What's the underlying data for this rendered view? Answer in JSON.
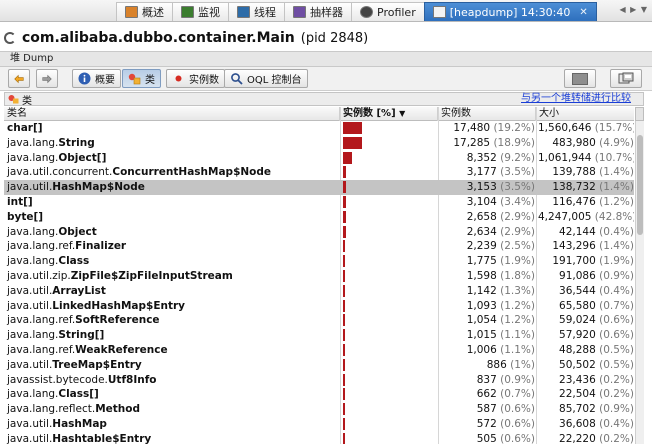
{
  "tabs": [
    {
      "label": "概述",
      "icon": "overview-icon"
    },
    {
      "label": "监视",
      "icon": "monitor-icon"
    },
    {
      "label": "线程",
      "icon": "threads-icon"
    },
    {
      "label": "抽样器",
      "icon": "sampler-icon"
    },
    {
      "label": "Profiler",
      "icon": "profiler-icon"
    },
    {
      "label": "[heapdump] 14:30:40",
      "icon": "heapdump-icon",
      "active": true
    }
  ],
  "header": {
    "app": "com.alibaba.dubbo.container.Main",
    "pid": "(pid 2848)"
  },
  "subtab": "堆 Dump",
  "toolbar": {
    "summary_label": "概要",
    "classes_label": "类",
    "instances_label": "实例数",
    "oql_label": "OQL 控制台"
  },
  "table": {
    "strip_label": "类",
    "compare_link": "与另一个堆转储进行比较",
    "columns": {
      "name": "类名",
      "instances_pct": "实例数 [%]",
      "instances": "实例数",
      "size": "大小"
    },
    "accent": "#b3181c",
    "rows": [
      {
        "pkg": "",
        "cls": "char[]",
        "count": "17,480",
        "count_pct": "(19.2%)",
        "size": "1,560,646",
        "size_pct": "(15.7%)",
        "frac": 19.2
      },
      {
        "pkg": "java.lang.",
        "cls": "String",
        "count": "17,285",
        "count_pct": "(18.9%)",
        "size": "483,980",
        "size_pct": "(4.9%)",
        "frac": 18.9
      },
      {
        "pkg": "java.lang.",
        "cls": "Object[]",
        "count": "8,352",
        "count_pct": "(9.2%)",
        "size": "1,061,944",
        "size_pct": "(10.7%)",
        "frac": 9.2
      },
      {
        "pkg": "java.util.concurrent.",
        "cls": "ConcurrentHashMap$Node",
        "count": "3,177",
        "count_pct": "(3.5%)",
        "size": "139,788",
        "size_pct": "(1.4%)",
        "frac": 3.5
      },
      {
        "pkg": "java.util.",
        "cls": "HashMap$Node",
        "count": "3,153",
        "count_pct": "(3.5%)",
        "size": "138,732",
        "size_pct": "(1.4%)",
        "frac": 3.5,
        "selected": true
      },
      {
        "pkg": "",
        "cls": "int[]",
        "count": "3,104",
        "count_pct": "(3.4%)",
        "size": "116,476",
        "size_pct": "(1.2%)",
        "frac": 3.4
      },
      {
        "pkg": "",
        "cls": "byte[]",
        "count": "2,658",
        "count_pct": "(2.9%)",
        "size": "4,247,005",
        "size_pct": "(42.8%)",
        "frac": 2.9
      },
      {
        "pkg": "java.lang.",
        "cls": "Object",
        "count": "2,634",
        "count_pct": "(2.9%)",
        "size": "42,144",
        "size_pct": "(0.4%)",
        "frac": 2.9
      },
      {
        "pkg": "java.lang.ref.",
        "cls": "Finalizer",
        "count": "2,239",
        "count_pct": "(2.5%)",
        "size": "143,296",
        "size_pct": "(1.4%)",
        "frac": 2.5
      },
      {
        "pkg": "java.lang.",
        "cls": "Class",
        "count": "1,775",
        "count_pct": "(1.9%)",
        "size": "191,700",
        "size_pct": "(1.9%)",
        "frac": 1.9
      },
      {
        "pkg": "java.util.zip.",
        "cls": "ZipFile$ZipFileInputStream",
        "count": "1,598",
        "count_pct": "(1.8%)",
        "size": "91,086",
        "size_pct": "(0.9%)",
        "frac": 1.8
      },
      {
        "pkg": "java.util.",
        "cls": "ArrayList",
        "count": "1,142",
        "count_pct": "(1.3%)",
        "size": "36,544",
        "size_pct": "(0.4%)",
        "frac": 1.3
      },
      {
        "pkg": "java.util.",
        "cls": "LinkedHashMap$Entry",
        "count": "1,093",
        "count_pct": "(1.2%)",
        "size": "65,580",
        "size_pct": "(0.7%)",
        "frac": 1.2
      },
      {
        "pkg": "java.lang.ref.",
        "cls": "SoftReference",
        "count": "1,054",
        "count_pct": "(1.2%)",
        "size": "59,024",
        "size_pct": "(0.6%)",
        "frac": 1.2
      },
      {
        "pkg": "java.lang.",
        "cls": "String[]",
        "count": "1,015",
        "count_pct": "(1.1%)",
        "size": "57,920",
        "size_pct": "(0.6%)",
        "frac": 1.1
      },
      {
        "pkg": "java.lang.ref.",
        "cls": "WeakReference",
        "count": "1,006",
        "count_pct": "(1.1%)",
        "size": "48,288",
        "size_pct": "(0.5%)",
        "frac": 1.1
      },
      {
        "pkg": "java.util.",
        "cls": "TreeMap$Entry",
        "count": "886",
        "count_pct": "(1%)",
        "size": "50,502",
        "size_pct": "(0.5%)",
        "frac": 1.0
      },
      {
        "pkg": "javassist.bytecode.",
        "cls": "Utf8Info",
        "count": "837",
        "count_pct": "(0.9%)",
        "size": "23,436",
        "size_pct": "(0.2%)",
        "frac": 0.9
      },
      {
        "pkg": "java.lang.",
        "cls": "Class[]",
        "count": "662",
        "count_pct": "(0.7%)",
        "size": "22,504",
        "size_pct": "(0.2%)",
        "frac": 0.7
      },
      {
        "pkg": "java.lang.reflect.",
        "cls": "Method",
        "count": "587",
        "count_pct": "(0.6%)",
        "size": "85,702",
        "size_pct": "(0.9%)",
        "frac": 0.6
      },
      {
        "pkg": "java.util.",
        "cls": "HashMap",
        "count": "572",
        "count_pct": "(0.6%)",
        "size": "36,608",
        "size_pct": "(0.4%)",
        "frac": 0.6
      },
      {
        "pkg": "java.util.",
        "cls": "Hashtable$Entry",
        "count": "505",
        "count_pct": "(0.6%)",
        "size": "22,220",
        "size_pct": "(0.2%)",
        "frac": 0.6
      }
    ]
  }
}
